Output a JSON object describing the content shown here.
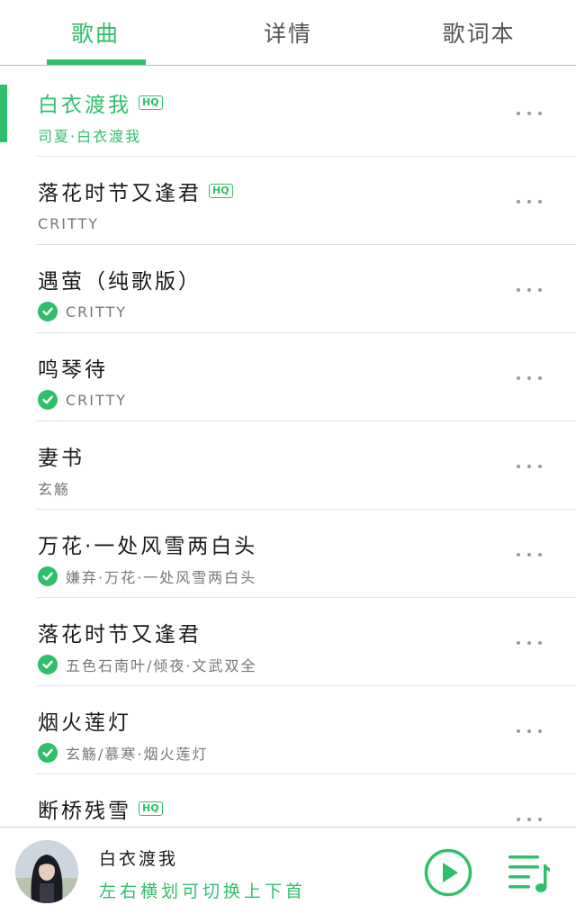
{
  "tabs": [
    {
      "label": "歌曲",
      "active": true
    },
    {
      "label": "详情",
      "active": false
    },
    {
      "label": "歌词本",
      "active": false
    }
  ],
  "songs": [
    {
      "title": "白衣渡我",
      "hq": true,
      "artist": "司夏·白衣渡我",
      "downloaded": false,
      "playing": true
    },
    {
      "title": "落花时节又逢君",
      "hq": true,
      "artist": "CRITTY",
      "downloaded": false,
      "playing": false
    },
    {
      "title": "遇萤（纯歌版）",
      "hq": false,
      "artist": "CRITTY",
      "downloaded": true,
      "playing": false
    },
    {
      "title": "鸣琴待",
      "hq": false,
      "artist": "CRITTY",
      "downloaded": true,
      "playing": false
    },
    {
      "title": "妻书",
      "hq": false,
      "artist": "玄觞",
      "downloaded": false,
      "playing": false
    },
    {
      "title": "万花·一处风雪两白头",
      "hq": false,
      "artist": "嫌弃·万花·一处风雪两白头",
      "downloaded": true,
      "playing": false
    },
    {
      "title": "落花时节又逢君",
      "hq": false,
      "artist": "五色石南叶/倾夜·文武双全",
      "downloaded": true,
      "playing": false
    },
    {
      "title": "烟火莲灯",
      "hq": false,
      "artist": "玄觞/慕寒·烟火莲灯",
      "downloaded": true,
      "playing": false
    },
    {
      "title": "断桥残雪",
      "hq": true,
      "artist": "",
      "downloaded": false,
      "playing": false
    }
  ],
  "hq_label": "HQ",
  "player": {
    "title": "白衣渡我",
    "hint": "左右横划可切换上下首"
  },
  "icons": {
    "more": "more-dots-icon",
    "downloaded": "check-circle-icon",
    "play": "play-circle-icon",
    "queue": "playlist-icon"
  },
  "colors": {
    "accent": "#2fbf6a",
    "text": "#1a1a1a",
    "secondary": "#777777"
  }
}
